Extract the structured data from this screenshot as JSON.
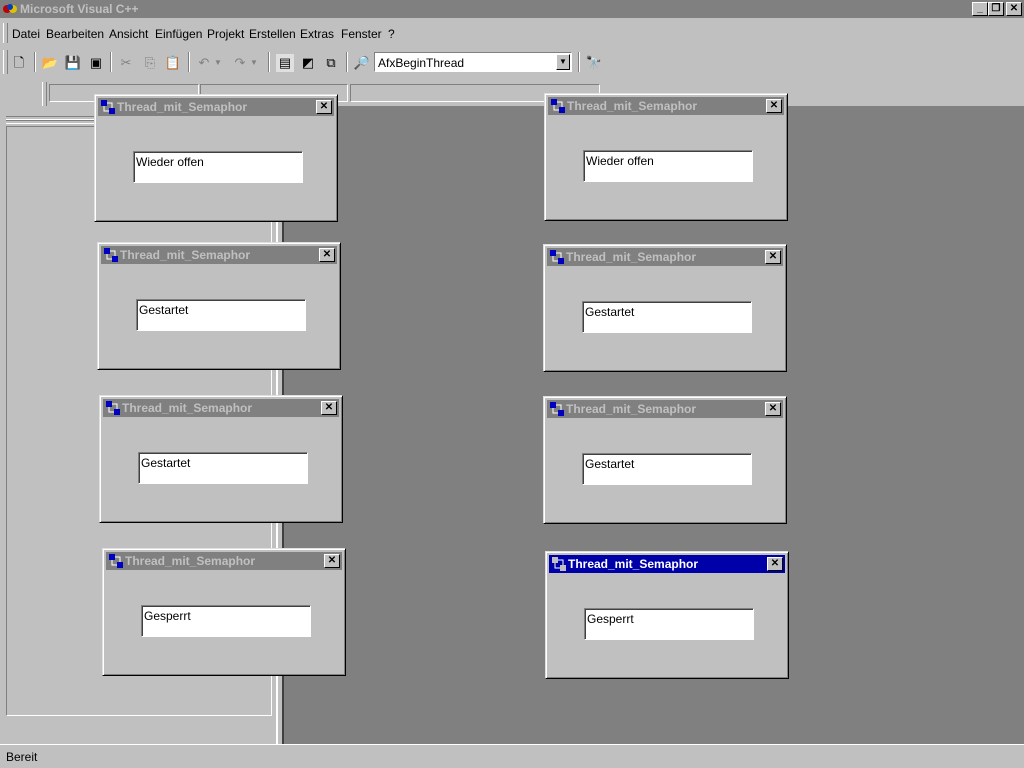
{
  "app": {
    "title": "Microsoft Visual C++"
  },
  "menu": [
    {
      "label": "Datei"
    },
    {
      "label": "Bearbeiten"
    },
    {
      "label": "Ansicht"
    },
    {
      "label": "Einfügen"
    },
    {
      "label": "Projekt"
    },
    {
      "label": "Erstellen"
    },
    {
      "label": "Extras"
    },
    {
      "label": "Fenster"
    },
    {
      "label": "?"
    }
  ],
  "toolbar": {
    "find_combo_value": "AfxBeginThread"
  },
  "dialogs": [
    {
      "title": "Thread_mit_Semaphor",
      "status": "Wieder offen"
    },
    {
      "title": "Thread_mit_Semaphor",
      "status": "Gestartet"
    },
    {
      "title": "Thread_mit_Semaphor",
      "status": "Gestartet"
    },
    {
      "title": "Thread_mit_Semaphor",
      "status": "Gesperrt"
    },
    {
      "title": "Thread_mit_Semaphor",
      "status": "Wieder offen"
    },
    {
      "title": "Thread_mit_Semaphor",
      "status": "Gestartet"
    },
    {
      "title": "Thread_mit_Semaphor",
      "status": "Gestartet"
    },
    {
      "title": "Thread_mit_Semaphor",
      "status": "Gesperrt"
    }
  ],
  "statusbar": {
    "text": "Bereit"
  },
  "colors": {
    "active_caption": "#0000a8",
    "inactive_caption": "#808080",
    "face": "#c0c0c0",
    "mdi_background": "#808080"
  }
}
